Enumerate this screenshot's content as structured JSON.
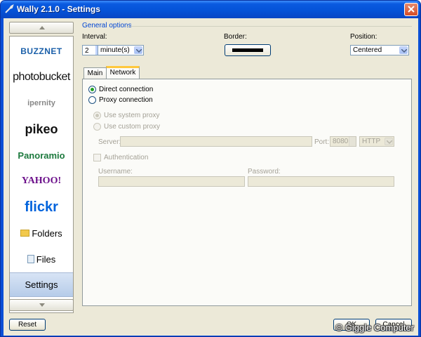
{
  "window": {
    "title": "Wally 2.1.0 - Settings"
  },
  "sidebar": {
    "items": [
      {
        "label": "BUZZNET",
        "icon": "buzznet-logo"
      },
      {
        "label": "photobucket",
        "icon": "photobucket-logo"
      },
      {
        "label": "ipernity",
        "icon": "ipernity-logo"
      },
      {
        "label": "pikeo",
        "icon": "pikeo-logo"
      },
      {
        "label": "Panoramio",
        "icon": "panoramio-logo"
      },
      {
        "label": "YAHOO!",
        "icon": "yahoo-logo"
      },
      {
        "label": "flickr",
        "icon": "flickr-logo"
      },
      {
        "label": "Folders",
        "icon": "folder-icon"
      },
      {
        "label": "Files",
        "icon": "files-icon"
      },
      {
        "label": "Settings",
        "icon": "",
        "selected": true
      }
    ]
  },
  "general": {
    "group_label": "General options",
    "interval_label": "Interval:",
    "interval_value": "2",
    "interval_unit": "minute(s)",
    "border_label": "Border:",
    "border_color": "#000000",
    "position_label": "Position:",
    "position_value": "Centered"
  },
  "tabs": {
    "main": "Main",
    "network": "Network"
  },
  "network": {
    "direct": "Direct connection",
    "proxy": "Proxy connection",
    "system_proxy": "Use system proxy",
    "custom_proxy": "Use custom proxy",
    "server_label": "Server:",
    "server_value": "",
    "port_label": "Port:",
    "port_value": "8080",
    "protocol": "HTTP",
    "authentication": "Authentication",
    "username_label": "Username:",
    "password_label": "Password:"
  },
  "buttons": {
    "reset": "Reset",
    "ok": "OK",
    "cancel": "Cancel"
  },
  "watermark": "© Giggle Computer"
}
